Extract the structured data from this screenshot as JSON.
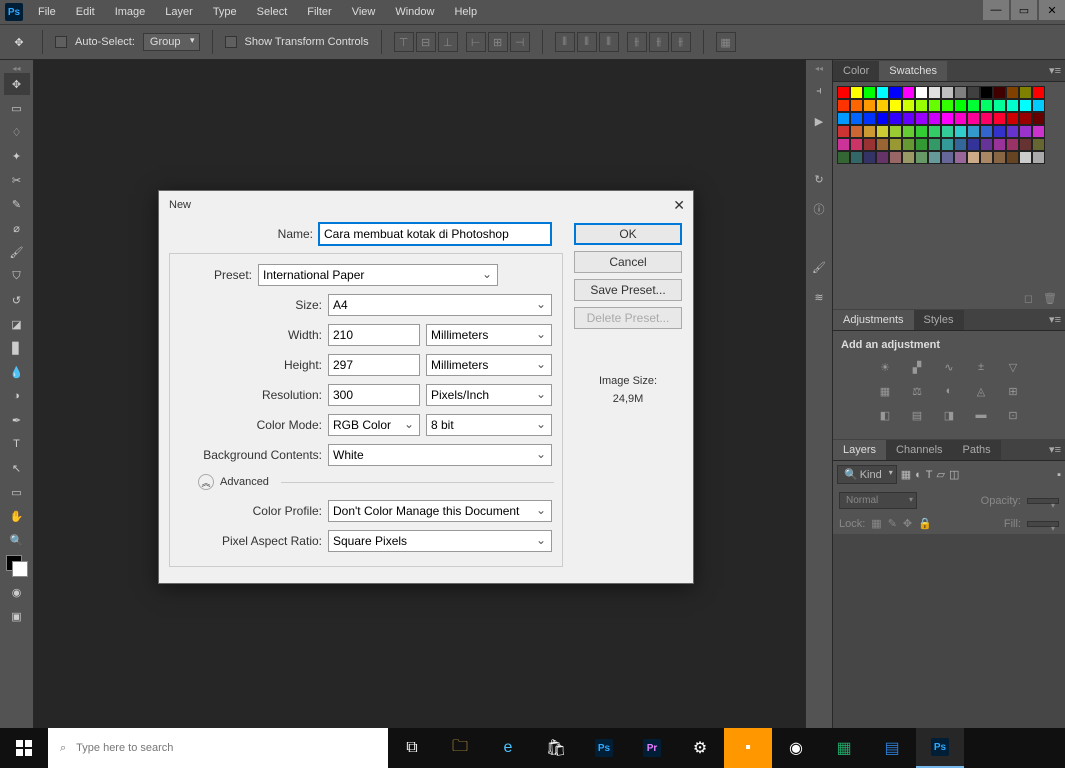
{
  "menubar": [
    "File",
    "Edit",
    "Image",
    "Layer",
    "Type",
    "Select",
    "Filter",
    "View",
    "Window",
    "Help"
  ],
  "optbar": {
    "autoSelect": "Auto-Select:",
    "group": "Group",
    "showTransform": "Show Transform Controls"
  },
  "dialog": {
    "title": "New",
    "labels": {
      "name": "Name:",
      "preset": "Preset:",
      "size": "Size:",
      "width": "Width:",
      "height": "Height:",
      "resolution": "Resolution:",
      "colorMode": "Color Mode:",
      "bgContents": "Background Contents:",
      "advanced": "Advanced",
      "colorProfile": "Color Profile:",
      "pixelAspect": "Pixel Aspect Ratio:"
    },
    "values": {
      "name": "Cara membuat kotak di Photoshop",
      "preset": "International Paper",
      "size": "A4",
      "width": "210",
      "widthUnit": "Millimeters",
      "height": "297",
      "heightUnit": "Millimeters",
      "resolution": "300",
      "resolutionUnit": "Pixels/Inch",
      "colorMode": "RGB Color",
      "bitDepth": "8 bit",
      "bgContents": "White",
      "colorProfile": "Don't Color Manage this Document",
      "pixelAspect": "Square Pixels"
    },
    "buttons": {
      "ok": "OK",
      "cancel": "Cancel",
      "savePreset": "Save Preset...",
      "deletePreset": "Delete Preset..."
    },
    "imageSizeLabel": "Image Size:",
    "imageSize": "24,9M"
  },
  "panels": {
    "colorTab": "Color",
    "swatchesTab": "Swatches",
    "adjustmentsTab": "Adjustments",
    "stylesTab": "Styles",
    "addAdjustment": "Add an adjustment",
    "layersTab": "Layers",
    "channelsTab": "Channels",
    "pathsTab": "Paths",
    "kind": "Kind",
    "normal": "Normal",
    "opacity": "Opacity:",
    "lock": "Lock:",
    "fill": "Fill:"
  },
  "taskbar": {
    "searchPlaceholder": "Type here to search"
  },
  "swatchColors": [
    "#ff0000",
    "#ffff00",
    "#00ff00",
    "#00ffff",
    "#0000ff",
    "#ff00ff",
    "#ffffff",
    "#e0e0e0",
    "#c0c0c0",
    "#808080",
    "#404040",
    "#000000",
    "#400000",
    "#804000",
    "#808000",
    "#ff0000",
    "#ff3300",
    "#ff6600",
    "#ff9900",
    "#ffcc00",
    "#ffff00",
    "#ccff00",
    "#99ff00",
    "#66ff00",
    "#33ff00",
    "#00ff00",
    "#00ff33",
    "#00ff66",
    "#00ff99",
    "#00ffcc",
    "#00ffff",
    "#00ccff",
    "#0099ff",
    "#0066ff",
    "#0033ff",
    "#0000ff",
    "#3300ff",
    "#6600ff",
    "#9900ff",
    "#cc00ff",
    "#ff00ff",
    "#ff00cc",
    "#ff0099",
    "#ff0066",
    "#ff0033",
    "#cc0000",
    "#990000",
    "#660000",
    "#cc3333",
    "#cc6633",
    "#cc9933",
    "#cccc33",
    "#99cc33",
    "#66cc33",
    "#33cc33",
    "#33cc66",
    "#33cc99",
    "#33cccc",
    "#3399cc",
    "#3366cc",
    "#3333cc",
    "#6633cc",
    "#9933cc",
    "#cc33cc",
    "#cc3399",
    "#cc3366",
    "#993333",
    "#996633",
    "#999933",
    "#669933",
    "#339933",
    "#339966",
    "#339999",
    "#336699",
    "#333399",
    "#663399",
    "#993399",
    "#993366",
    "#663333",
    "#666633",
    "#336633",
    "#336666",
    "#333366",
    "#663366",
    "#996666",
    "#999966",
    "#669966",
    "#669999",
    "#666699",
    "#996699",
    "#ccaa88",
    "#aa8866",
    "#886644",
    "#664422",
    "#cccccc",
    "#aaaaaa"
  ]
}
